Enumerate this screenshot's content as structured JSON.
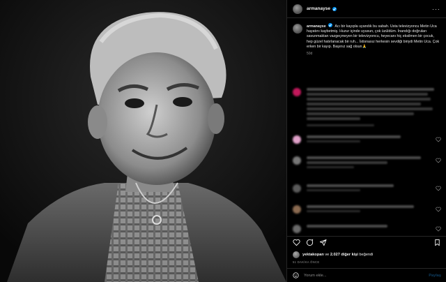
{
  "post": {
    "username": "armanayse",
    "caption_username": "armanayse",
    "caption": "Acı bir kayıpla uyandık bu sabah. Usta televizyoncu Metin Uca hayatını kaybetmiş. Huzur içinde uyusun, çok üzüldüm. İnandığı doğruları savunmaktan vazgeçmeyen bir televizyoncu, heyecanı hiç eksilmen bir çocuk, hep güzel hatırlanacak bir ruh... İstisnasız herkesin sevdiği biriydi Metin Uca. Çok erken bir kayıp. Başınız sağ olsun🙏",
    "age": "50d",
    "likes_user": "yektakopan",
    "likes_mid": " ve ",
    "likes_count": "2.027 diğer kişi",
    "likes_suffix": " beğendi",
    "time_ago": "51 DAKİKA ÖNCE"
  },
  "composer": {
    "placeholder": "Yorum ekle...",
    "post_label": "Paylaş"
  },
  "icons": {
    "more": "more-options-icon",
    "like": "heart-icon",
    "comment": "comment-icon",
    "share": "share-icon",
    "save": "bookmark-icon",
    "emoji": "emoji-icon"
  },
  "colors": {
    "background": "#000000",
    "verified": "#0095f6",
    "muted": "#8e8e8e",
    "divider": "#262626"
  }
}
